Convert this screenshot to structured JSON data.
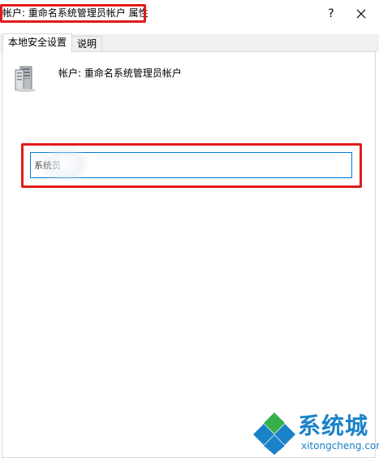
{
  "window": {
    "title": "帐户: 重命名系统管理员帐户 属性",
    "help_label": "?",
    "close_icon": "close-icon"
  },
  "tabs": [
    {
      "label": "本地安全设置",
      "active": true
    },
    {
      "label": "说明",
      "active": false
    }
  ],
  "policy": {
    "icon": "server-policy-icon",
    "name": "帐户: 重命名系统管理员帐户"
  },
  "account_name": {
    "value": "系统员"
  },
  "watermark": {
    "brand": "系统城",
    "domain": "xitongcheng.com"
  },
  "colors": {
    "highlight": "#e11b1b",
    "focus_border": "#0078d7",
    "watermark_blue": "#1a82c8"
  }
}
